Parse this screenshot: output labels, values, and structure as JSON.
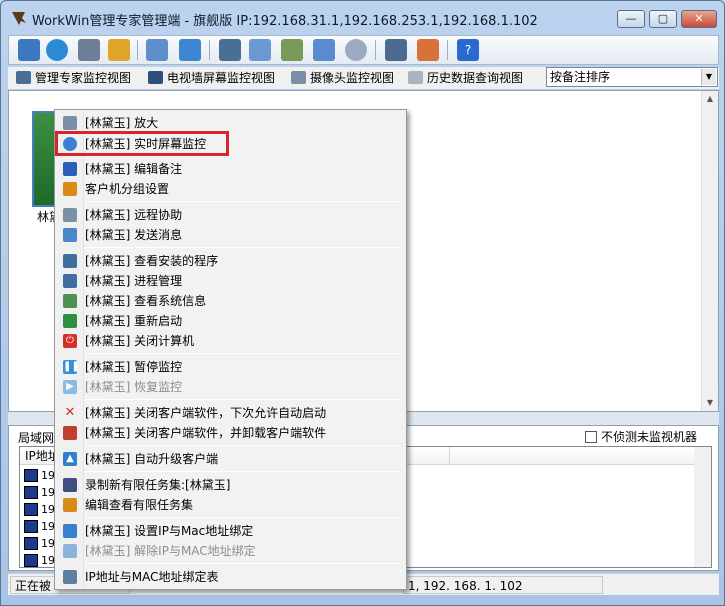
{
  "window": {
    "title": "WorkWin管理专家管理端 - 旗舰版 IP:192.168.31.1,192.168.253.1,192.168.1.102",
    "minimize": "—",
    "maximize": "▢",
    "close": "✕"
  },
  "toolbar": {
    "icons": [
      "pc-group-icon",
      "globe-icon",
      "settings-icon",
      "users-icon",
      "chart-icon",
      "usb-icon",
      "monitor-icon",
      "send-icon",
      "mountain-icon",
      "window-icon",
      "disc-icon",
      "server-icon",
      "message-icon",
      "help-icon"
    ],
    "help_glyph": "?"
  },
  "tabs": {
    "items": [
      {
        "label": "管理专家监控视图"
      },
      {
        "label": "电视墙屏幕监控视图"
      },
      {
        "label": "摄像头监控视图"
      },
      {
        "label": "历史数据查询视图"
      }
    ],
    "sort_value": "按备注排序"
  },
  "main": {
    "thumb_label": "林黛"
  },
  "lower": {
    "title": "局域网",
    "not_detect_label": "不侦测未监视机器",
    "header_ip": "IP地址",
    "rows": [
      "19",
      "19",
      "19",
      "19",
      "19",
      "19"
    ]
  },
  "status": {
    "left": "正在被",
    "right": "1, 192. 168. 1. 102"
  },
  "context_menu": {
    "items": [
      {
        "label": "[林黛玉] 放大",
        "icon": "zoom-in-icon",
        "color": "#7b8fa6",
        "disabled": false
      },
      {
        "label": "[林黛玉] 实时屏幕监控",
        "icon": "magnifier-icon",
        "color": "#3d7fd0",
        "disabled": false
      },
      {
        "label": "[林黛玉] 编辑备注",
        "icon": "pencil-icon",
        "color": "#2b5fb8",
        "disabled": false
      },
      {
        "label": "客户机分组设置",
        "icon": "group-icon",
        "color": "#d98b17",
        "disabled": false
      },
      {
        "label": "[林黛玉] 远程协助",
        "icon": "remote-icon",
        "color": "#7b8fa6",
        "disabled": false
      },
      {
        "label": "[林黛玉] 发送消息",
        "icon": "mail-icon",
        "color": "#4a87c9",
        "disabled": false
      },
      {
        "label": "[林黛玉] 查看安装的程序",
        "icon": "programs-icon",
        "color": "#3f6f9f",
        "disabled": false
      },
      {
        "label": "[林黛玉] 进程管理",
        "icon": "process-icon",
        "color": "#3f6f9f",
        "disabled": false
      },
      {
        "label": "[林黛玉] 查看系统信息",
        "icon": "sysinfo-icon",
        "color": "#4f8f4f",
        "disabled": false
      },
      {
        "label": "[林黛玉] 重新启动",
        "icon": "restart-icon",
        "color": "#2f8f3f",
        "disabled": false
      },
      {
        "label": "[林黛玉] 关闭计算机",
        "icon": "power-icon",
        "color": "#d2312a",
        "disabled": false
      },
      {
        "label": "[林黛玉] 暂停监控",
        "icon": "pause-icon",
        "color": "#3a8ed8",
        "disabled": false
      },
      {
        "label": "[林黛玉] 恢复监控",
        "icon": "play-icon",
        "color": "#3a8ed8",
        "disabled": true
      },
      {
        "label": "[林黛玉] 关闭客户端软件，下次允许自动启动",
        "icon": "close-x-icon",
        "color": "#d2312a",
        "disabled": false
      },
      {
        "label": "[林黛玉] 关闭客户端软件，并卸载客户端软件",
        "icon": "uninstall-icon",
        "color": "#c04030",
        "disabled": false
      },
      {
        "label": "[林黛玉] 自动升级客户端",
        "icon": "upgrade-icon",
        "color": "#2f7fd0",
        "disabled": false
      },
      {
        "label": "录制新有限任务集:[林黛玉]",
        "icon": "record-icon",
        "color": "#3f4f7f",
        "disabled": false
      },
      {
        "label": "编辑查看有限任务集",
        "icon": "task-edit-icon",
        "color": "#d98b17",
        "disabled": false
      },
      {
        "label": "[林黛玉] 设置IP与Mac地址绑定",
        "icon": "lock-icon",
        "color": "#3a7fd0",
        "disabled": false
      },
      {
        "label": "[林黛玉] 解除IP与MAC地址绑定",
        "icon": "unlock-icon",
        "color": "#3a7fd0",
        "disabled": true
      },
      {
        "label": "IP地址与MAC地址绑定表",
        "icon": "table-icon",
        "color": "#5f7f9f",
        "disabled": false
      }
    ]
  }
}
